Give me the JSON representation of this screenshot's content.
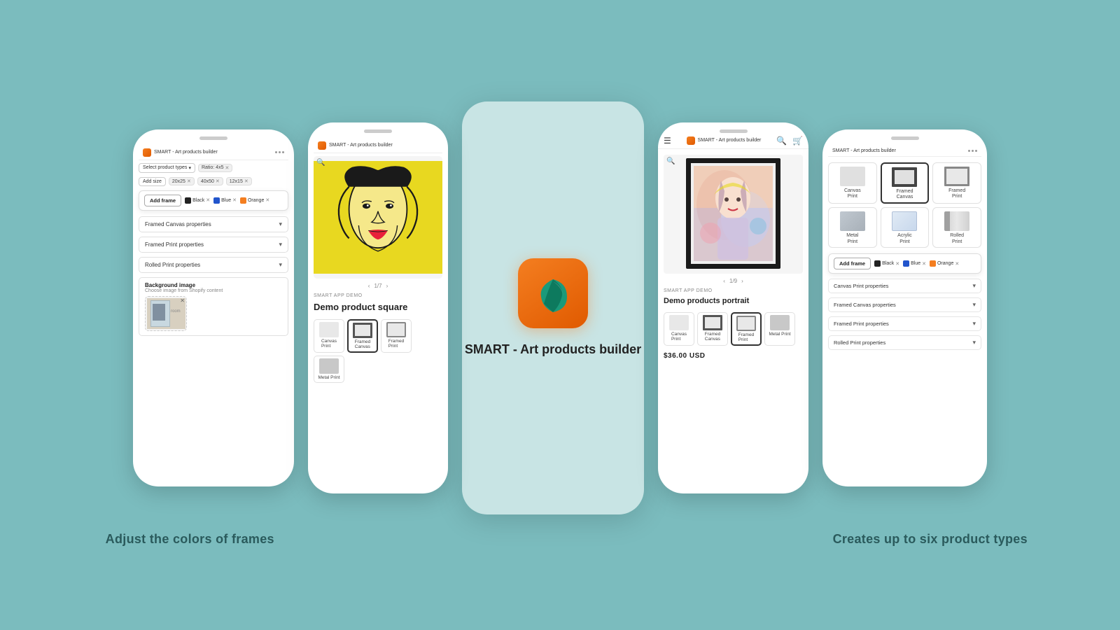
{
  "background_color": "#7bbcbe",
  "app_name": "SMART - Art products builder",
  "logo_title": "SMART - Art products builder",
  "phone1": {
    "title": "SMART - Art products builder",
    "select_placeholder": "Select product types",
    "ratio_tag": "Ratio: 4x5",
    "size_tags": [
      "20x25",
      "40x50",
      "12x15"
    ],
    "add_frame_label": "Add frame",
    "colors": [
      {
        "name": "Black",
        "hex": "#222222"
      },
      {
        "name": "Blue",
        "hex": "#2255cc"
      },
      {
        "name": "Orange",
        "hex": "#f47e20"
      }
    ],
    "accordions": [
      "Framed Canvas properties",
      "Framed Print properties",
      "Rolled Print properties"
    ],
    "bg_label": "Background image",
    "bg_sublabel": "Choose image from Shopify content"
  },
  "phone2": {
    "demo_label": "SMART APP DEMO",
    "product_title": "Demo product square",
    "nav": "1/7",
    "types": [
      {
        "label": "Canvas Print",
        "selected": false
      },
      {
        "label": "Framed Canvas",
        "selected": true
      },
      {
        "label": "Framed Print",
        "selected": false
      },
      {
        "label": "Metal Print",
        "selected": false
      }
    ]
  },
  "phone_center": {
    "title": "SMART - Art products builder"
  },
  "phone4": {
    "demo_label": "SMART APP DEMO",
    "product_title": "Demo products portrait",
    "price": "$36.00 USD",
    "nav": "1/9",
    "types": [
      {
        "label": "Canvas Print",
        "selected": false
      },
      {
        "label": "Framed Canvas",
        "selected": false
      },
      {
        "label": "Framed Print",
        "selected": true
      },
      {
        "label": "Metal Print",
        "selected": false
      }
    ]
  },
  "phone5": {
    "title": "SMART - Art products builder",
    "types": [
      {
        "label": "Canvas Print",
        "selected": false
      },
      {
        "label": "Framed Canvas",
        "selected": true
      },
      {
        "label": "Framed Print",
        "selected": false
      },
      {
        "label": "Metal Print",
        "selected": false
      },
      {
        "label": "Acrylic Print",
        "selected": false
      },
      {
        "label": "Rolled Print",
        "selected": false
      }
    ],
    "add_frame_label": "Add frame",
    "colors": [
      {
        "name": "Black",
        "hex": "#222222"
      },
      {
        "name": "Blue",
        "hex": "#2255cc"
      },
      {
        "name": "Orange",
        "hex": "#f47e20"
      }
    ],
    "accordions": [
      "Canvas Print properties",
      "Framed Canvas properties",
      "Framed Print properties",
      "Rolled Print properties"
    ]
  },
  "bottom_labels": {
    "left": "Adjust the colors of  frames",
    "right": "Creates up to six product types"
  }
}
